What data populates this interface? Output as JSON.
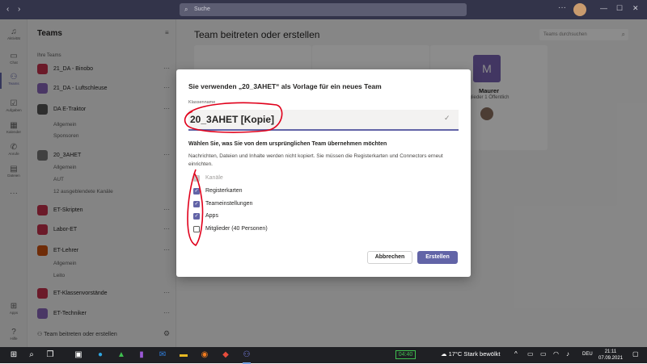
{
  "titlebar": {
    "search_placeholder": "Suche",
    "more": "···",
    "icons": [
      "back-arrow-icon",
      "forward-arrow-icon",
      "search-icon",
      "minimize-icon",
      "maximize-icon",
      "close-icon"
    ]
  },
  "rail": {
    "items": [
      {
        "label": "Aktivität",
        "icon": "bell-icon"
      },
      {
        "label": "Chat",
        "icon": "chat-icon"
      },
      {
        "label": "Teams",
        "icon": "teams-icon",
        "active": true
      },
      {
        "label": "Aufgaben",
        "icon": "tasks-icon"
      },
      {
        "label": "Kalender",
        "icon": "calendar-icon"
      },
      {
        "label": "Anrufe",
        "icon": "phone-icon"
      },
      {
        "label": "Dateien",
        "icon": "files-icon"
      },
      {
        "label": "···",
        "icon": "more-icon"
      },
      {
        "label": "Apps",
        "icon": "apps-icon"
      },
      {
        "label": "Hilfe",
        "icon": "help-icon"
      }
    ]
  },
  "teams_panel": {
    "title": "Teams",
    "section": "Ihre Teams",
    "teams": [
      {
        "name": "21_DA - Binobo",
        "color": "#c4314b"
      },
      {
        "name": "21_DA - Luftschleuse",
        "color": "#8764b8"
      },
      {
        "name": "DA E-Traktor",
        "color": "#555555"
      },
      {
        "name": "20_3AHET",
        "color": "#777777"
      },
      {
        "name": "ET-Skripten",
        "color": "#c4314b"
      },
      {
        "name": "Labor-ET",
        "color": "#c4314b"
      },
      {
        "name": "ET-Lehrer",
        "color": "#ca5010"
      },
      {
        "name": "ET-Klassenvorstände",
        "color": "#c4314b"
      },
      {
        "name": "ET-Techniker",
        "color": "#8764b8"
      }
    ],
    "channels": [
      "Allgemein",
      "Sponsoren",
      "Allgemein",
      "AUT",
      "12 ausgeblendete Kanäle",
      "Allgemein",
      "Leito"
    ],
    "join_link": "Team beitreten oder erstellen"
  },
  "main": {
    "title": "Team beitreten oder erstellen",
    "search_placeholder": "Teams durchsuchen",
    "card": {
      "avatar": "M",
      "name": "Maurer",
      "sub": "glieder 1 Öffentlich"
    }
  },
  "dialog": {
    "title": "Sie verwenden „20_3AHET“ als Vorlage für ein neues Team",
    "field_label": "Klassenname",
    "field_value": "20_3AHET [Kopie]",
    "subtitle": "Wählen Sie, was Sie von dem ursprünglichen Team übernehmen möchten",
    "description": "Nachrichten, Dateien und Inhalte werden nicht kopiert. Sie müssen die Registerkarten und Connectors erneut einrichten.",
    "options": [
      {
        "label": "Kanäle",
        "checked": true,
        "disabled": true
      },
      {
        "label": "Registerkarten",
        "checked": true,
        "disabled": false
      },
      {
        "label": "Teameinstellungen",
        "checked": true,
        "disabled": false
      },
      {
        "label": "Apps",
        "checked": true,
        "disabled": false
      },
      {
        "label": "Mitglieder (40 Personen)",
        "checked": false,
        "disabled": false
      }
    ],
    "cancel": "Abbrechen",
    "create": "Erstellen",
    "annotation_color": "#e0001b"
  },
  "taskbar": {
    "battery_text": "04:40",
    "weather": "17°C  Stark bewölkt",
    "lang": "DEU",
    "time": "21:11",
    "date": "07.09.2021"
  },
  "colors": {
    "accent": "#6264a7",
    "titlebar": "#33344a",
    "taskbar": "#1f2024"
  }
}
